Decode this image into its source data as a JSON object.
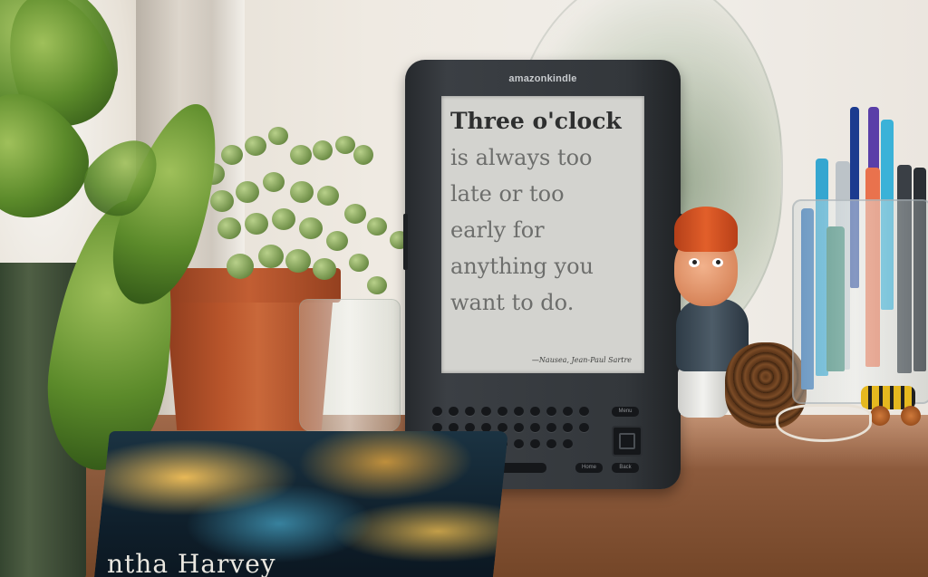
{
  "scene": {
    "kind": "photograph",
    "subject": "e-reader on a desk with houseplants and desk objects"
  },
  "kindle": {
    "brand": "amazonkindle",
    "quote_lines": [
      "Three o'clock",
      "is always too",
      "late or too",
      "early for",
      "anything you",
      "want to do."
    ],
    "attribution": "—Nausea, Jean-Paul Sartre",
    "keys": {
      "menu": "Menu",
      "home": "Home",
      "back": "Back"
    }
  },
  "book": {
    "author_visible": "ntha Harvey"
  },
  "colors": {
    "kindle_body": "#33373b",
    "screen": "#d3d3cf",
    "desk": "#8c5a3c",
    "pot": "#b9552b"
  }
}
